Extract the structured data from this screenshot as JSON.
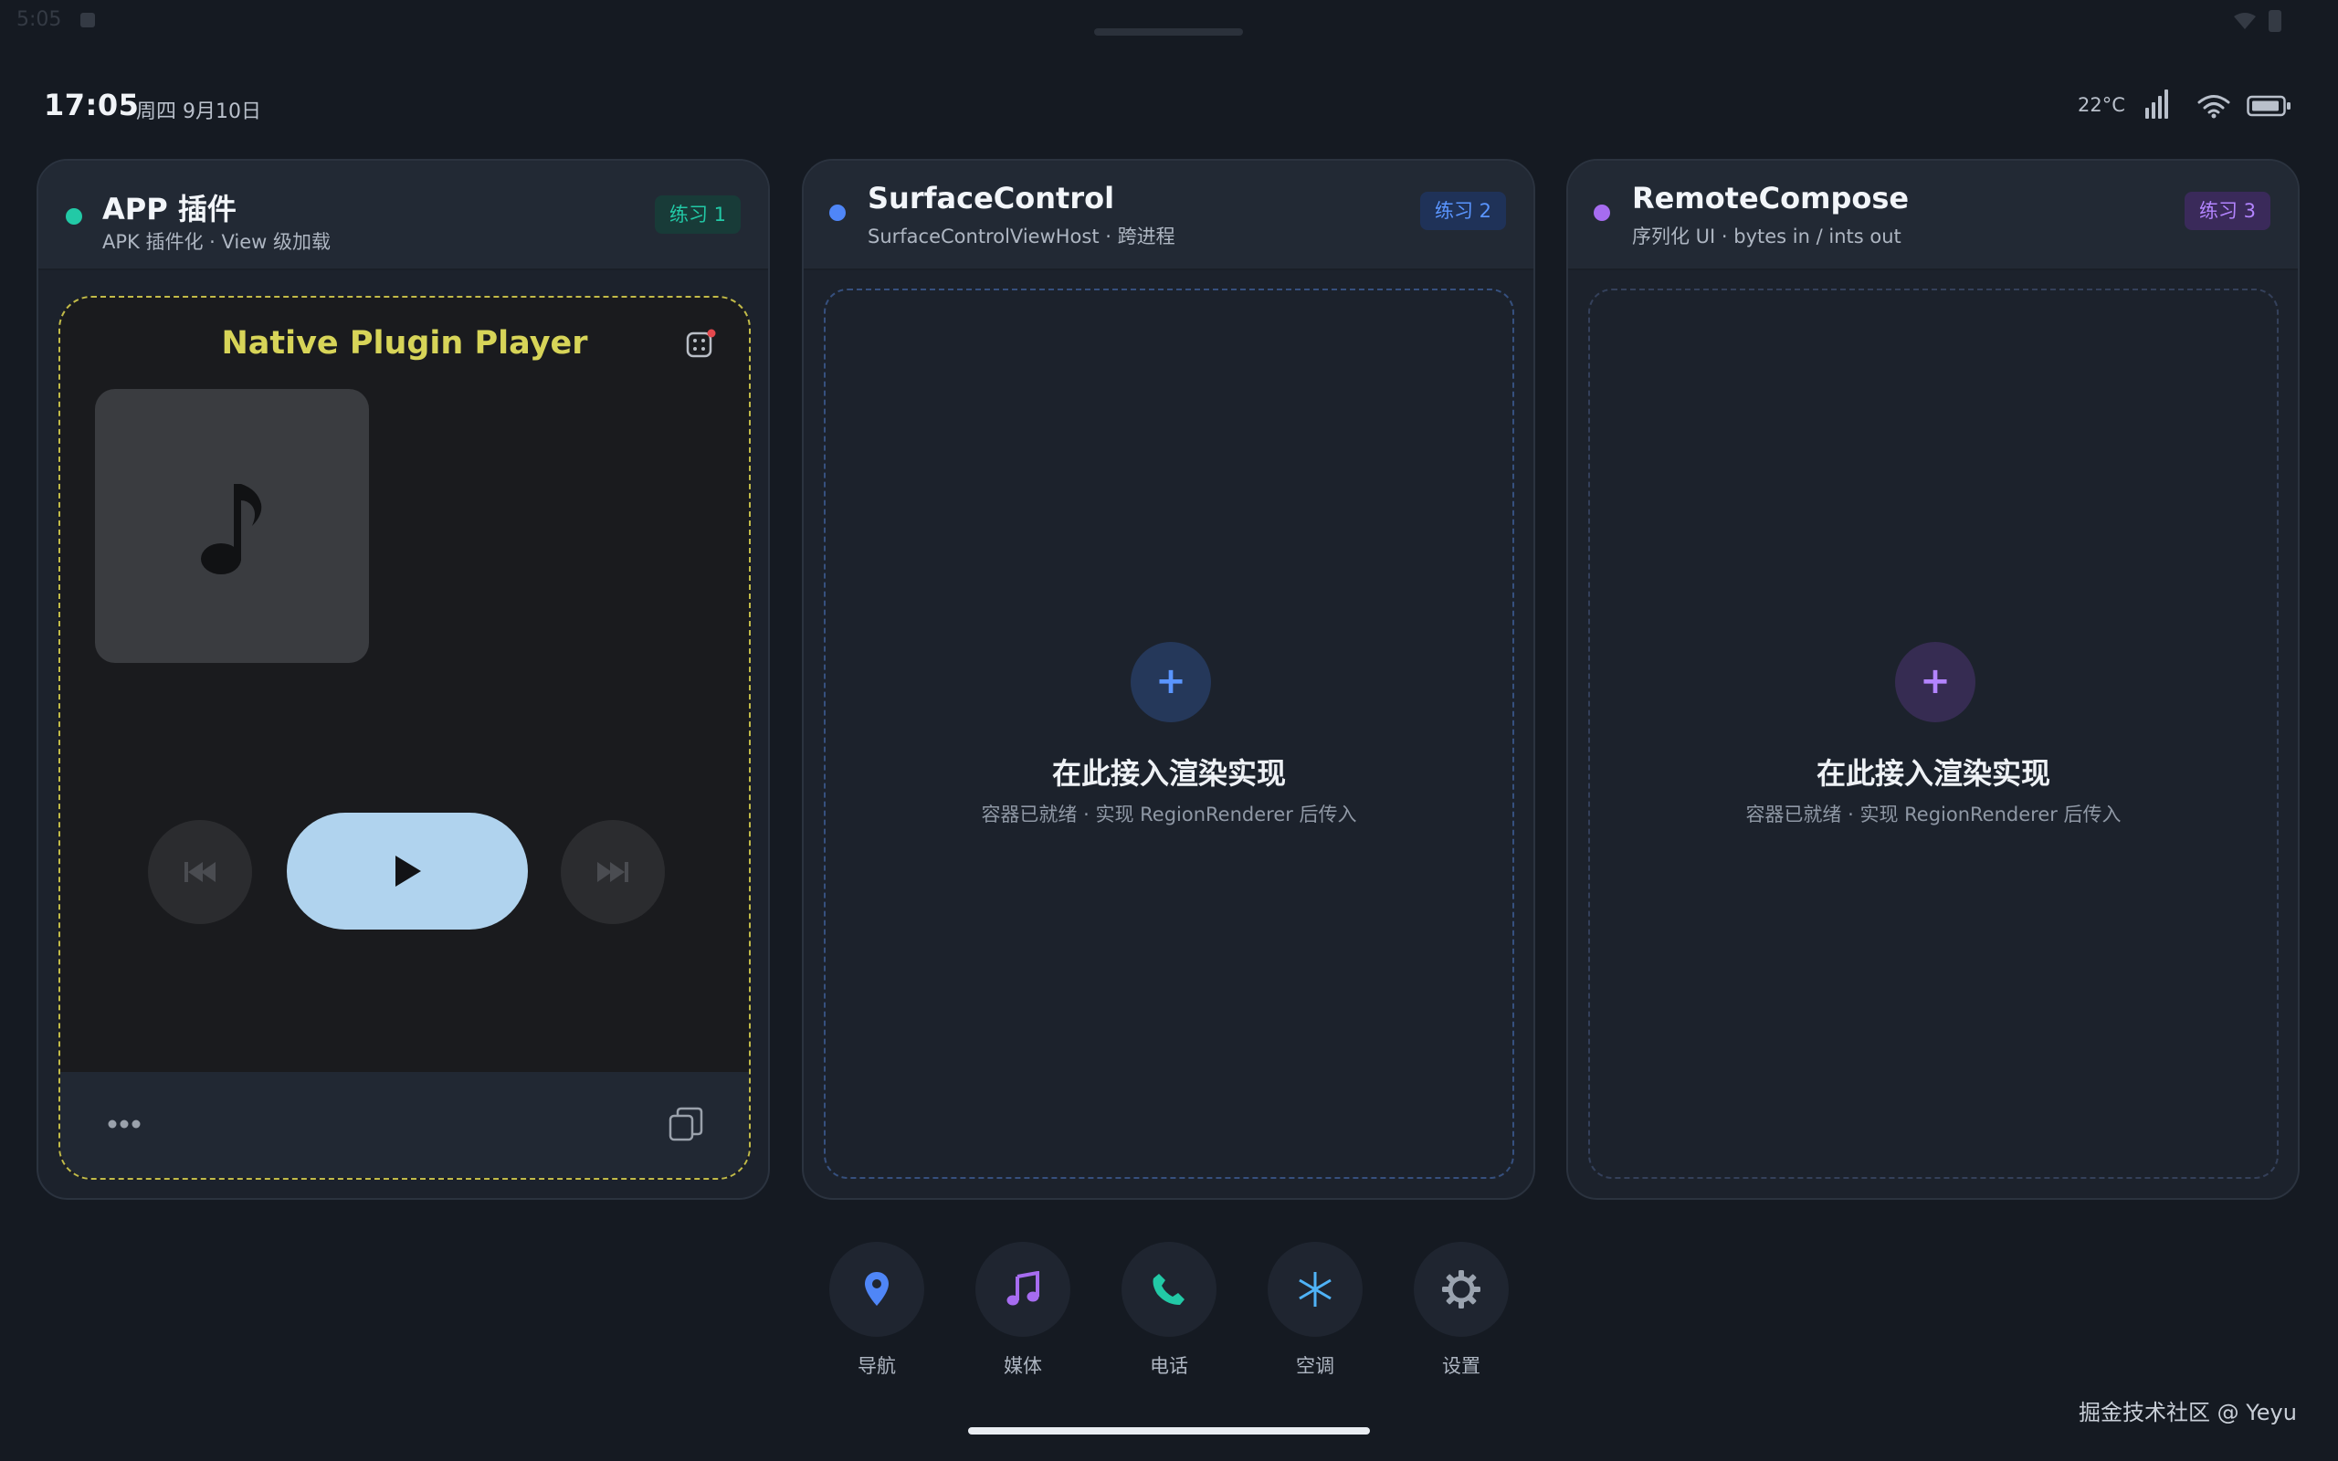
{
  "system": {
    "time": "5:05"
  },
  "header": {
    "time": "17:05",
    "date": "周四 9月10日",
    "temperature": "22°C"
  },
  "panels": [
    {
      "title": "APP 插件",
      "subtitle": "APK 插件化 · View 级加载",
      "badge": "练习 1",
      "accent": "#22c9a6",
      "player": {
        "title": "Native Plugin Player"
      }
    },
    {
      "title": "SurfaceControl",
      "subtitle": "SurfaceControlViewHost · 跨进程",
      "badge": "练习 2",
      "accent": "#4f86f7",
      "empty_title": "在此接入渲染实现",
      "empty_subtitle": "容器已就绪 · 实现 RegionRenderer 后传入",
      "add_symbol": "+"
    },
    {
      "title": "RemoteCompose",
      "subtitle": "序列化 UI · bytes in / ints out",
      "badge": "练习 3",
      "accent": "#a66cf0",
      "empty_title": "在此接入渲染实现",
      "empty_subtitle": "容器已就绪 · 实现 RegionRenderer 后传入",
      "add_symbol": "+"
    }
  ],
  "dock": [
    {
      "label": "导航",
      "icon": "location-pin-icon",
      "color": "#4f86f7"
    },
    {
      "label": "媒体",
      "icon": "music-note-icon",
      "color": "#a66cf0"
    },
    {
      "label": "电话",
      "icon": "phone-icon",
      "color": "#22c9a6"
    },
    {
      "label": "空调",
      "icon": "snowflake-icon",
      "color": "#4fb3f7"
    },
    {
      "label": "设置",
      "icon": "gear-icon",
      "color": "#9aa3af"
    }
  ],
  "watermark": "掘金技术社区 @ Yeyu",
  "colors": {
    "background": "#151a22",
    "panel": "#1c222c",
    "play_button": "#b0d3ee",
    "player_title": "#d7d458"
  }
}
